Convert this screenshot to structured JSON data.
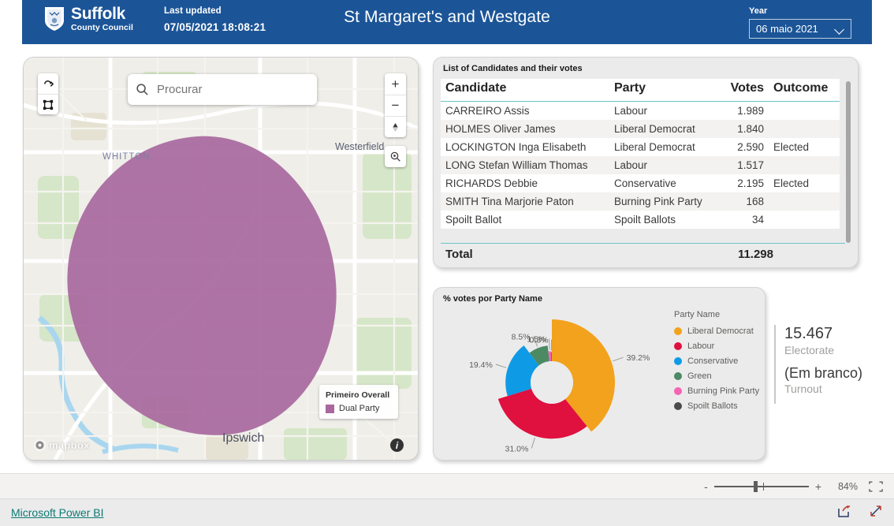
{
  "header": {
    "logo_main": "Suffolk",
    "logo_sub": "County Council",
    "updated_label": "Last updated",
    "updated_value": "07/05/2021 18:08:21",
    "title": "St Margaret's and Westgate",
    "year_label": "Year",
    "year_value": "06 maio 2021",
    "bg_color": "#1c5597"
  },
  "map": {
    "search_placeholder": "Procurar",
    "labels": {
      "ipswich": "Ipswich",
      "westerfield": "Westerfield",
      "whitton": "WHITTON"
    },
    "controls": {
      "zoom_in": "+",
      "zoom_out": "−"
    },
    "legend": {
      "title": "Primeiro Overall",
      "item_label": "Dual Party",
      "item_color": "#a8689e"
    },
    "attribution": "mapbox",
    "info_label": "i"
  },
  "table_card": {
    "title": "List of Candidates and their votes",
    "columns": [
      "Candidate",
      "Party",
      "Votes",
      "Outcome"
    ],
    "rows": [
      {
        "candidate": "CARREIRO Assis",
        "party": "Labour",
        "votes": "1.989",
        "outcome": ""
      },
      {
        "candidate": "HOLMES Oliver James",
        "party": "Liberal Democrat",
        "votes": "1.840",
        "outcome": ""
      },
      {
        "candidate": "LOCKINGTON Inga Elisabeth",
        "party": "Liberal Democrat",
        "votes": "2.590",
        "outcome": "Elected"
      },
      {
        "candidate": "LONG Stefan William Thomas",
        "party": "Labour",
        "votes": "1.517",
        "outcome": ""
      },
      {
        "candidate": "RICHARDS Debbie",
        "party": "Conservative",
        "votes": "2.195",
        "outcome": "Elected"
      },
      {
        "candidate": "SMITH Tina Marjorie Paton",
        "party": "Burning Pink Party",
        "votes": "168",
        "outcome": ""
      },
      {
        "candidate": "Spoilt Ballot",
        "party": "Spoilt Ballots",
        "votes": "34",
        "outcome": ""
      }
    ],
    "total_label": "Total",
    "total_value": "11.298"
  },
  "chart_data": {
    "type": "pie",
    "title": "% votes por Party Name",
    "legend_title": "Party Name",
    "legend_position": "right",
    "categories": [
      "Liberal Democrat",
      "Labour",
      "Conservative",
      "Green",
      "Burning Pink Party",
      "Spoilt Ballots"
    ],
    "values": [
      39.2,
      31.0,
      19.4,
      8.5,
      1.5,
      0.3
    ],
    "labels": [
      "39.2%",
      "31.0%",
      "19.4%",
      "8.5%",
      "1.5%",
      "0.3%"
    ],
    "colors": [
      "#f2a21c",
      "#e0103f",
      "#0f9ae5",
      "#4c8a64",
      "#f763b5",
      "#4a4a4a"
    ],
    "xlabel": "",
    "ylabel": ""
  },
  "kpi": {
    "electorate_value": "15.467",
    "electorate_label": "Electorate",
    "turnout_value": "(Em branco)",
    "turnout_label": "Turnout"
  },
  "statusbar": {
    "zoom_minus": "-",
    "zoom_plus": "+",
    "zoom_percent": "84%"
  },
  "footer": {
    "powerbi_link": "Microsoft Power BI"
  }
}
